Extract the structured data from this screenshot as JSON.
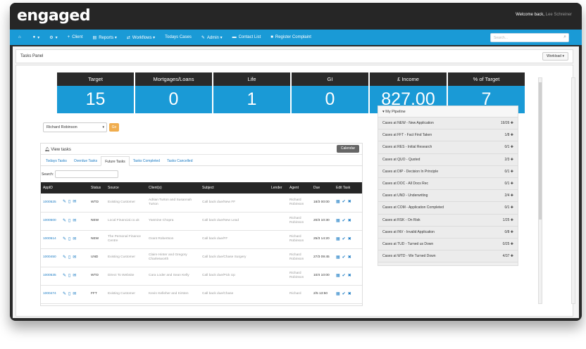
{
  "app": {
    "logo": "engaged"
  },
  "header": {
    "welcome": "Welcome back,",
    "user": "Lee Schreiner"
  },
  "nav": {
    "items": [
      {
        "icon": "home-icon",
        "glyph": "⌂",
        "label": ""
      },
      {
        "icon": "globe-icon",
        "glyph": "●",
        "label": "▾"
      },
      {
        "icon": "gear-icon",
        "glyph": "⚙",
        "label": "▾"
      },
      {
        "icon": "plus-icon",
        "glyph": "+",
        "label": "Client"
      },
      {
        "icon": "chart-icon",
        "glyph": "▤",
        "label": "Reports ▾"
      },
      {
        "icon": "shuffle-icon",
        "glyph": "⇄",
        "label": "Workflows ▾"
      },
      {
        "icon": "",
        "glyph": "",
        "label": "Todays Cases"
      },
      {
        "icon": "wrench-icon",
        "glyph": "✎",
        "label": "Admin ▾"
      },
      {
        "icon": "contact-icon",
        "glyph": "▬",
        "label": "Contact List"
      },
      {
        "icon": "complaint-icon",
        "glyph": "■",
        "label": "Register Complaint"
      }
    ],
    "search_placeholder": "Search..."
  },
  "panel": {
    "title": "Tasks Panel",
    "workload_label": "Workload ▾"
  },
  "kpis": [
    {
      "label": "Target",
      "value": "15"
    },
    {
      "label": "Mortgages/Loans",
      "value": "0"
    },
    {
      "label": "Life",
      "value": "1"
    },
    {
      "label": "GI",
      "value": "0"
    },
    {
      "label": "£ Income",
      "value": "827.00"
    },
    {
      "label": "% of Target",
      "value": "7"
    }
  ],
  "filter": {
    "selected": "Richard Robinson",
    "go_label": "Go"
  },
  "tasks": {
    "title": "View tasks",
    "calendar_label": "Calendar",
    "tabs": [
      "Todays Tasks",
      "Overdue Tasks",
      "Future Tasks",
      "Tasks Completed",
      "Tasks Cancelled"
    ],
    "active_tab": "Future Tasks",
    "search_label": "Search:",
    "columns": [
      "AppID",
      "",
      "Status",
      "Source",
      "Client(s)",
      "Subject",
      "Lender",
      "Agent",
      "Due",
      "Edit Task"
    ],
    "rows": [
      {
        "app": "1000525",
        "status": "WTD",
        "source": "Existing Customer",
        "clients": "Adrian Turton and Susannah Turton",
        "subject": "Call back due/New FF",
        "lender": "",
        "agent": "Richard Robinson",
        "due": "18/3 00:00"
      },
      {
        "app": "1000500",
        "status": "NEW",
        "source": "Local Financial.co.uk",
        "clients": "Yasmine Chopra",
        "subject": "Call back due/New Lead",
        "lender": "",
        "agent": "Richard Robinson",
        "due": "20/3 10:30"
      },
      {
        "app": "1000514",
        "status": "NEW",
        "source": "The Personal Finance Centre",
        "clients": "Grant Robertson",
        "subject": "Call back due/FF",
        "lender": "",
        "agent": "Richard Robinson",
        "due": "25/3 14:20"
      },
      {
        "app": "1000450",
        "status": "UND",
        "source": "Existing Customer",
        "clients": "Claire Hinter and Gregory Charlesworth",
        "subject": "Call back due/Chase Surgery",
        "lender": "",
        "agent": "Richard Robinson",
        "due": "27/3 09:45"
      },
      {
        "app": "1000535",
        "status": "WTD",
        "source": "Direct To Website",
        "clients": "Cara Loder and Sean Kelly",
        "subject": "Call back due/Pick Up",
        "lender": "",
        "agent": "Richard Robinson",
        "due": "10/4 10:00"
      },
      {
        "app": "1000474",
        "status": "FFT",
        "source": "Existing Customer",
        "clients": "Kevin Kelleher and Kirsten",
        "subject": "Call back due/Chase",
        "lender": "",
        "agent": "Richard",
        "due": "2/5 13:50"
      }
    ]
  },
  "pipeline": {
    "title": "My Pipeline",
    "rows": [
      {
        "label": "Cases at NEW - New Application",
        "count": "19/26"
      },
      {
        "label": "Cases at FFT - Fact Find Taken",
        "count": "1/8"
      },
      {
        "label": "Cases at RES - Initial Research",
        "count": "0/1"
      },
      {
        "label": "Cases at QUO - Quoted",
        "count": "2/3"
      },
      {
        "label": "Cases at DIP - Decision In Principle",
        "count": "0/1"
      },
      {
        "label": "Cases at DOC - All Docs Rec",
        "count": "0/1"
      },
      {
        "label": "Cases at UND - Underwriting",
        "count": "2/4"
      },
      {
        "label": "Cases at COM - Application Completed",
        "count": "0/1"
      },
      {
        "label": "Cases at RSK - On Risk",
        "count": "1/25"
      },
      {
        "label": "Cases at INV - Invalid Application",
        "count": "0/8"
      },
      {
        "label": "Cases at TUD - Turned us Down",
        "count": "0/25"
      },
      {
        "label": "Cases at WTD - We Turned Down",
        "count": "4/37"
      }
    ]
  }
}
